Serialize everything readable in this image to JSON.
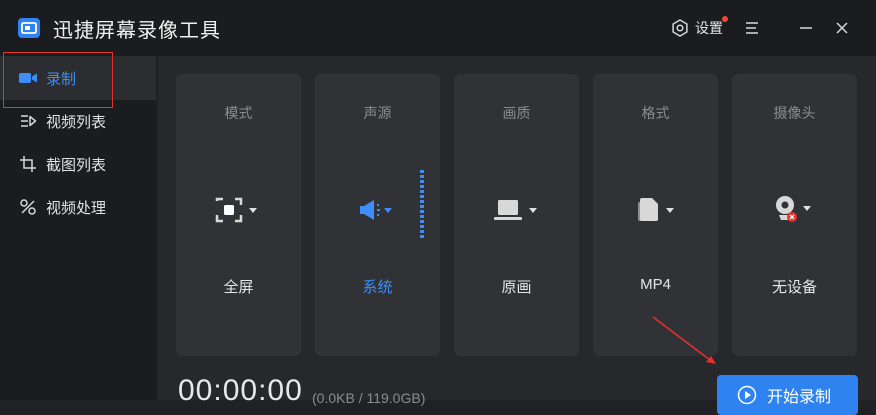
{
  "app": {
    "title": "迅捷屏幕录像工具",
    "settings_label": "设置"
  },
  "sidebar": {
    "items": [
      {
        "label": "录制",
        "icon": "video-camera-icon"
      },
      {
        "label": "视频列表",
        "icon": "video-list-icon"
      },
      {
        "label": "截图列表",
        "icon": "screenshot-list-icon"
      },
      {
        "label": "视频处理",
        "icon": "video-process-icon"
      }
    ]
  },
  "cards": [
    {
      "title": "模式",
      "value": "全屏",
      "icon": "fullscreen-icon"
    },
    {
      "title": "声源",
      "value": "系统",
      "icon": "speaker-icon"
    },
    {
      "title": "画质",
      "value": "原画",
      "icon": "monitor-icon"
    },
    {
      "title": "格式",
      "value": "MP4",
      "icon": "file-icon"
    },
    {
      "title": "摄像头",
      "value": "无设备",
      "icon": "webcam-icon"
    }
  ],
  "status": {
    "timer": "00:00:00",
    "size": "(0.0KB / 119.0GB)"
  },
  "start_label": "开始录制",
  "colors": {
    "accent": "#2e83f1",
    "active_text": "#3d8ef8",
    "highlight_box": "#e8302c",
    "background": "#202124",
    "card": "#313236"
  }
}
